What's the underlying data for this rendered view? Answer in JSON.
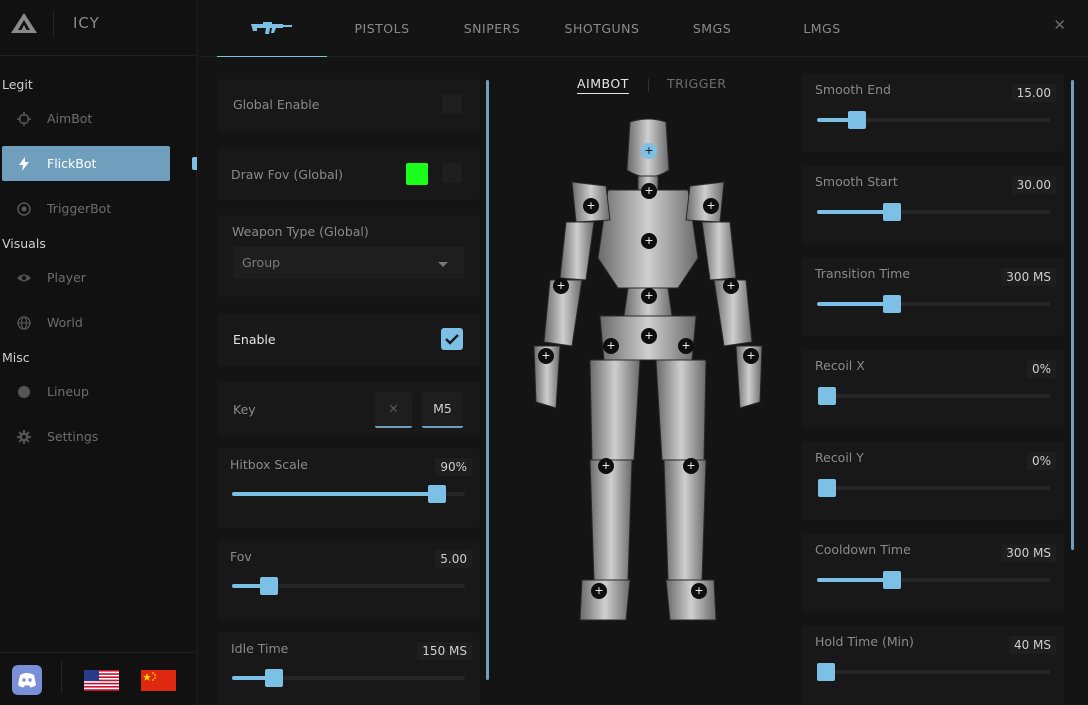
{
  "app": {
    "name": "ICY"
  },
  "sidebar": {
    "sections": [
      {
        "title": "Legit",
        "items": [
          {
            "label": "AimBot",
            "icon": "crosshair-icon"
          },
          {
            "label": "FlickBot",
            "icon": "bolt-icon",
            "active": true
          },
          {
            "label": "TriggerBot",
            "icon": "target-icon"
          }
        ]
      },
      {
        "title": "Visuals",
        "items": [
          {
            "label": "Player",
            "icon": "eye-icon"
          },
          {
            "label": "World",
            "icon": "globe-icon"
          }
        ]
      },
      {
        "title": "Misc",
        "items": [
          {
            "label": "Lineup",
            "icon": "circle-icon"
          },
          {
            "label": "Settings",
            "icon": "gear-icon"
          }
        ]
      }
    ],
    "footer": {
      "discord": "discord-icon",
      "flags": [
        "us-flag-icon",
        "cn-flag-icon"
      ]
    }
  },
  "tabs": {
    "weapon_icon": "rifle-icon",
    "items": [
      "PISTOLS",
      "SNIPERS",
      "SHOTGUNS",
      "SMGS",
      "LMGS"
    ],
    "close": "✕"
  },
  "left": {
    "global_enable": "Global Enable",
    "draw_fov": {
      "label": "Draw Fov (Global)",
      "color": "#1aff1a"
    },
    "weapon_type": {
      "label": "Weapon Type (Global)",
      "value": "Group"
    },
    "enable": {
      "label": "Enable",
      "checked": true
    },
    "key": {
      "label": "Key",
      "clear": "✕",
      "value": "M5"
    },
    "hitbox_scale": {
      "label": "Hitbox Scale",
      "value": "90%",
      "fraction": 0.88
    },
    "fov": {
      "label": "Fov",
      "value": "5.00",
      "fraction": 0.16
    },
    "idle_time": {
      "label": "Idle Time",
      "value": "150 MS",
      "fraction": 0.18
    }
  },
  "middle": {
    "tabs": [
      "AIMBOT",
      "TRIGGER"
    ],
    "hitpoint_symbol": "+"
  },
  "right": {
    "smooth_end": {
      "label": "Smooth End",
      "value": "15.00",
      "fraction": 0.17
    },
    "smooth_start": {
      "label": "Smooth Start",
      "value": "30.00",
      "fraction": 0.32
    },
    "transition_time": {
      "label": "Transition Time",
      "value": "300 MS",
      "fraction": 0.32
    },
    "recoil_x": {
      "label": "Recoil X",
      "value": "0%",
      "fraction": 0.0
    },
    "recoil_y": {
      "label": "Recoil Y",
      "value": "0%",
      "fraction": 0.0
    },
    "cooldown_time": {
      "label": "Cooldown Time",
      "value": "300 MS",
      "fraction": 0.32
    },
    "hold_time": {
      "label": "Hold Time (Min)",
      "value": "40 MS",
      "fraction": 0.04
    }
  },
  "colors": {
    "accent": "#7cc0e5",
    "active_nav": "#6f9fbd",
    "background": "#141414",
    "card": "#181818"
  }
}
